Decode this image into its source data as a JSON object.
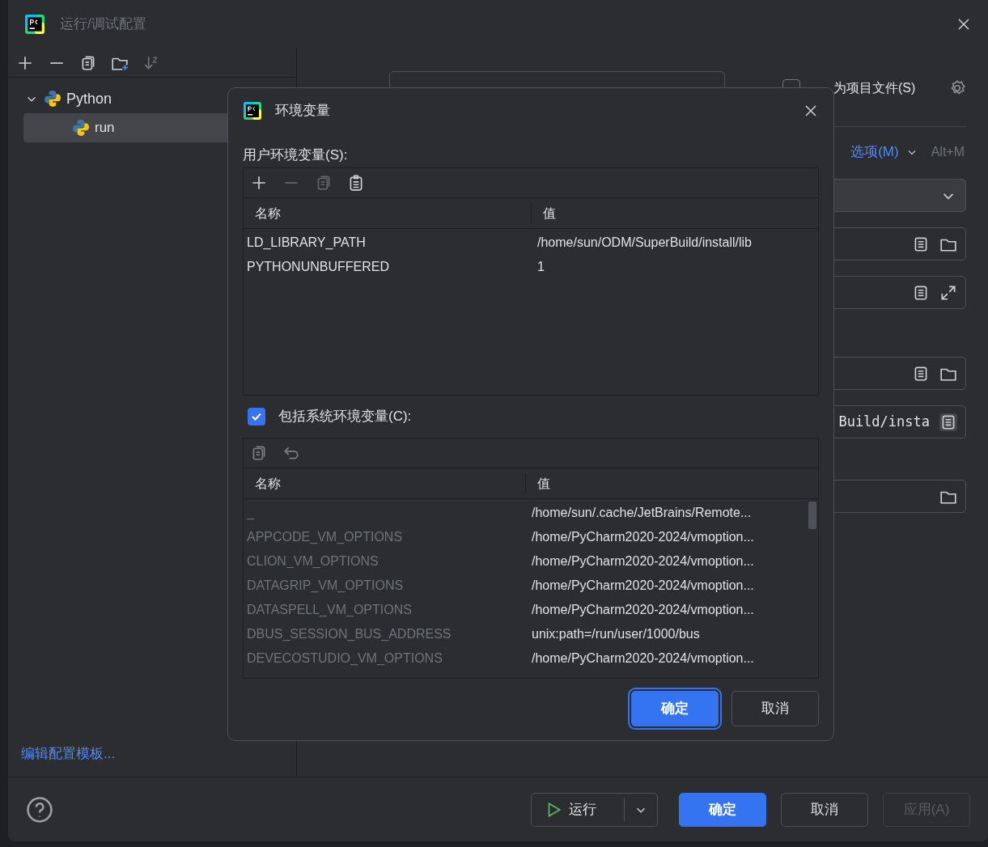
{
  "window": {
    "title": "运行/调试配置"
  },
  "sidebar": {
    "tree": [
      {
        "label": "Python",
        "expanded": true,
        "selected": false,
        "children": [
          {
            "label": "run",
            "selected": true
          }
        ]
      }
    ],
    "footer_link": "编辑配置模板..."
  },
  "form": {
    "store_checkbox": {
      "label": "为项目文件(S)",
      "checked": false
    },
    "options_link": "选项(M)",
    "options_shortcut": "Alt+M",
    "field_text": "Build/insta"
  },
  "dialog": {
    "title": "环境变量",
    "user_label": "用户环境变量(S):",
    "user_table": {
      "columns": [
        "名称",
        "值"
      ],
      "rows": [
        {
          "name": "LD_LIBRARY_PATH",
          "value": "/home/sun/ODM/SuperBuild/install/lib"
        },
        {
          "name": "PYTHONUNBUFFERED",
          "value": "1"
        }
      ]
    },
    "include_system": {
      "label": "包括系统环境变量(C):",
      "checked": true
    },
    "system_table": {
      "columns": [
        "名称",
        "值"
      ],
      "rows": [
        {
          "name": "_",
          "value": "/home/sun/.cache/JetBrains/Remote..."
        },
        {
          "name": "APPCODE_VM_OPTIONS",
          "value": "/home/PyCharm2020-2024/vmoption..."
        },
        {
          "name": "CLION_VM_OPTIONS",
          "value": "/home/PyCharm2020-2024/vmoption..."
        },
        {
          "name": "DATAGRIP_VM_OPTIONS",
          "value": "/home/PyCharm2020-2024/vmoption..."
        },
        {
          "name": "DATASPELL_VM_OPTIONS",
          "value": "/home/PyCharm2020-2024/vmoption..."
        },
        {
          "name": "DBUS_SESSION_BUS_ADDRESS",
          "value": "unix:path=/run/user/1000/bus"
        },
        {
          "name": "DEVECOSTUDIO_VM_OPTIONS",
          "value": "/home/PyCharm2020-2024/vmoption..."
        }
      ]
    },
    "buttons": [
      {
        "label": "确定",
        "kind": "primary",
        "focused": true
      },
      {
        "label": "取消",
        "kind": "secondary",
        "focused": false
      }
    ]
  },
  "bottom_bar": {
    "run_button": "运行",
    "buttons": [
      {
        "label": "确定",
        "kind": "primary",
        "disabled": false
      },
      {
        "label": "取消",
        "kind": "secondary",
        "disabled": false
      },
      {
        "label": "应用(A)",
        "kind": "secondary",
        "disabled": true
      }
    ]
  }
}
